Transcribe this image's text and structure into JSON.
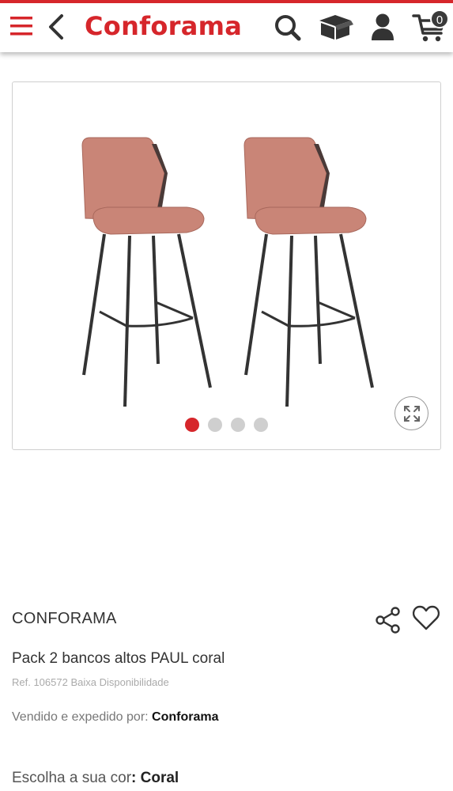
{
  "header": {
    "logo": "Conforama",
    "cart_count": "0",
    "brand_color": "#d6262b",
    "icons": [
      "menu-icon",
      "back-icon",
      "search-icon",
      "box-icon",
      "user-icon",
      "cart-icon"
    ]
  },
  "gallery": {
    "image_subject": "two coral bar stools",
    "dots": [
      {
        "active": true
      },
      {
        "active": false
      },
      {
        "active": false
      },
      {
        "active": false
      }
    ],
    "expand_icon": "expand-icon"
  },
  "product": {
    "brand": "CONFORAMA",
    "title": "Pack 2 bancos altos PAUL coral",
    "ref": "Ref. 106572 Baixa Disponibilidade",
    "seller_label": "Vendido e expedido por: ",
    "seller_name": "Conforama",
    "color_label": "Escolha a sua cor",
    "color_value": ": Coral",
    "share_icon": "share-icon",
    "favorite_icon": "heart-icon"
  }
}
